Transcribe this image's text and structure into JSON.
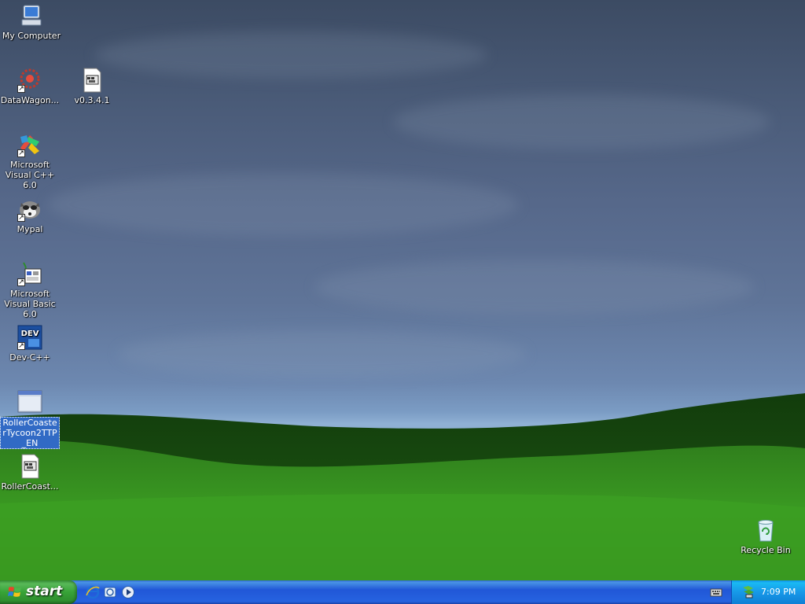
{
  "desktop": {
    "icons": [
      {
        "label": "My Computer",
        "icon": "my-computer-icon"
      },
      {
        "label": "DataWagon...",
        "icon": "datawagon-icon"
      },
      {
        "label": "v0.3.4.1",
        "icon": "document-icon"
      },
      {
        "label": "Microsoft Visual C++ 6.0",
        "icon": "visual-cpp-icon"
      },
      {
        "label": "Mypal",
        "icon": "mypal-icon"
      },
      {
        "label": "Microsoft Visual Basic 6.0",
        "icon": "visual-basic-icon"
      },
      {
        "label": "Dev-C++",
        "icon": "dev-cpp-icon"
      },
      {
        "label": "RollerCoasterTycoon2TTP_EN",
        "icon": "window-app-icon"
      },
      {
        "label": "RollerCoast...",
        "icon": "document-icon"
      },
      {
        "label": "Recycle Bin",
        "icon": "recycle-bin-icon"
      }
    ],
    "dev_badge": "DEV"
  },
  "taskbar": {
    "start_label": "start",
    "quick_launch": [
      "ie-icon",
      "outlook-express-icon",
      "media-player-icon"
    ],
    "clock": "7:09 PM"
  }
}
